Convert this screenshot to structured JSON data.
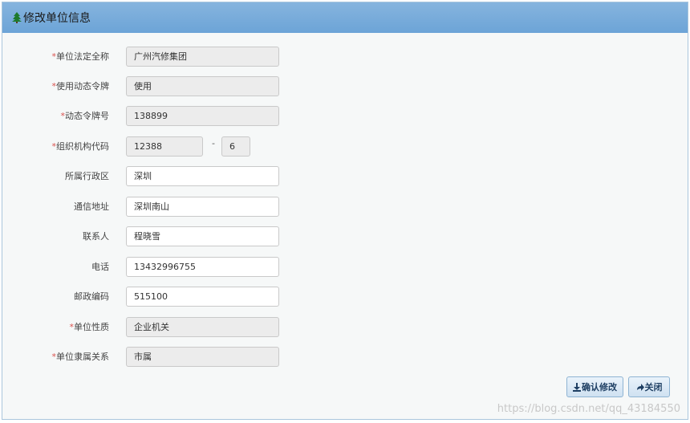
{
  "header": {
    "title": "修改单位信息",
    "icon": "tree-icon"
  },
  "fields": {
    "unit_name": {
      "label": "单位法定全称",
      "required": "*",
      "value": "广州汽修集团"
    },
    "dynamic_token_use": {
      "label": "使用动态令牌",
      "required": "*",
      "value": "使用"
    },
    "token_number": {
      "label": "动态令牌号",
      "required": "*",
      "value": "138899"
    },
    "org_code": {
      "label": "组织机构代码",
      "required": "*",
      "value": "12388",
      "separator": "-",
      "suffix": "6"
    },
    "district": {
      "label": "所属行政区",
      "value": "深圳"
    },
    "address": {
      "label": "通信地址",
      "value": "深圳南山"
    },
    "contact": {
      "label": "联系人",
      "value": "程晓雪"
    },
    "phone": {
      "label": "电话",
      "value": "13432996755"
    },
    "postcode": {
      "label": "邮政编码",
      "value": "515100"
    },
    "unit_nature": {
      "label": "单位性质",
      "required": "*",
      "value": "企业机关"
    },
    "affiliation": {
      "label": "单位隶属关系",
      "required": "*",
      "value": "市属"
    }
  },
  "buttons": {
    "confirm": {
      "label": "确认修改",
      "icon": "download-icon"
    },
    "close": {
      "label": "关闭",
      "icon": "arrow-right-icon"
    }
  },
  "watermark": "https://blog.csdn.net/qq_43184550",
  "colors": {
    "header": "#6ca4d7",
    "required": "#d9534f",
    "readonly_bg": "#ececec",
    "button_text": "#1e3f63"
  }
}
